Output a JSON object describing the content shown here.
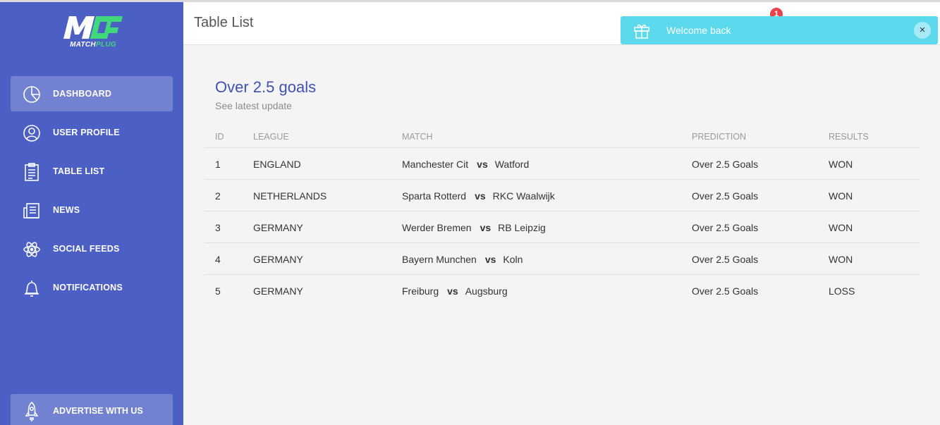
{
  "app": {
    "logo_text_white": "MATCH",
    "logo_text_green": "PLUG"
  },
  "sidebar": {
    "items": [
      {
        "label": "Dashboard",
        "icon": "chart-pie-icon",
        "active": true
      },
      {
        "label": "User Profile",
        "icon": "user-icon",
        "active": false
      },
      {
        "label": "Table List",
        "icon": "clipboard-icon",
        "active": false
      },
      {
        "label": "News",
        "icon": "newspaper-icon",
        "active": false
      },
      {
        "label": "Social Feeds",
        "icon": "atom-icon",
        "active": false
      },
      {
        "label": "Notifications",
        "icon": "bell-icon",
        "active": false
      }
    ],
    "advertise": {
      "label": "Advertise with us",
      "icon": "rocket-icon"
    }
  },
  "header": {
    "title": "Table List",
    "notification_count": "1"
  },
  "toast": {
    "message": "Welcome back",
    "close": "×"
  },
  "card": {
    "title": "Over 2.5 goals",
    "subtitle": "See latest update"
  },
  "table": {
    "columns": [
      "ID",
      "League",
      "Match",
      "Prediction",
      "Results"
    ],
    "vs_label": "vs",
    "rows": [
      {
        "id": "1",
        "league": "ENGLAND",
        "home": "Manchester Cit",
        "away": "Watford",
        "prediction": "Over 2.5 Goals",
        "result": "WON"
      },
      {
        "id": "2",
        "league": "NETHERLANDS",
        "home": "Sparta Rotterd",
        "away": "RKC Waalwijk",
        "prediction": "Over 2.5 Goals",
        "result": "WON"
      },
      {
        "id": "3",
        "league": "GERMANY",
        "home": "Werder Bremen",
        "away": "RB Leipzig",
        "prediction": "Over 2.5 Goals",
        "result": "WON"
      },
      {
        "id": "4",
        "league": "GERMANY",
        "home": "Bayern Munchen",
        "away": "Koln",
        "prediction": "Over 2.5 Goals",
        "result": "WON"
      },
      {
        "id": "5",
        "league": "GERMANY",
        "home": "Freiburg",
        "away": "Augsburg",
        "prediction": "Over 2.5 Goals",
        "result": "LOSS"
      }
    ]
  },
  "colors": {
    "sidebar": "#4b5fc4",
    "accent": "#3f51b5",
    "toast": "#5dd9ee",
    "badge": "#e8434b",
    "logo_green": "#3fd87a"
  }
}
